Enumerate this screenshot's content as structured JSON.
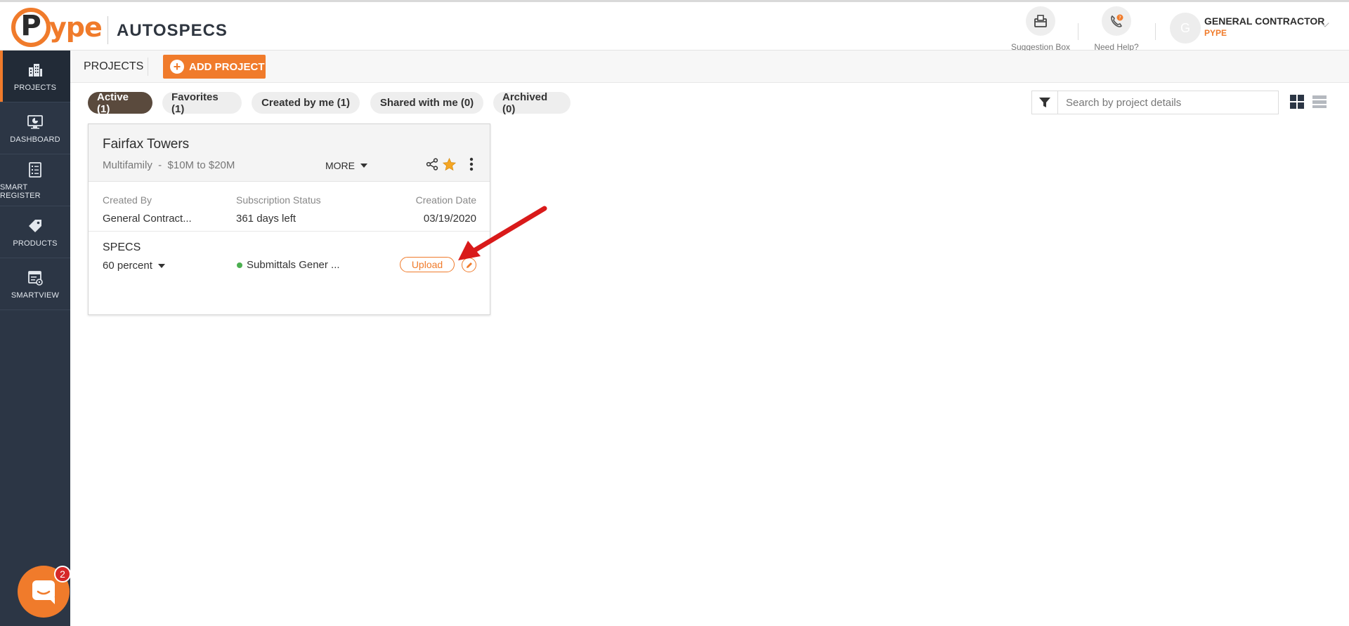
{
  "header": {
    "logo_letter": "P",
    "logo_rest": "ype",
    "app_name": "AUTOSPECS",
    "actions": [
      {
        "label": "Suggestion Box",
        "icon": "suggestion-box-icon"
      },
      {
        "label": "Need Help?",
        "icon": "phone-help-icon"
      }
    ],
    "user": {
      "initial": "G",
      "name": "GENERAL CONTRACTOR",
      "org": "PYPE"
    }
  },
  "sidebar": {
    "items": [
      {
        "label": "PROJECTS",
        "icon": "building-icon",
        "active": true
      },
      {
        "label": "DASHBOARD",
        "icon": "monitor-icon",
        "active": false
      },
      {
        "label": "SMART REGISTER",
        "icon": "register-icon",
        "active": false
      },
      {
        "label": "PRODUCTS",
        "icon": "tag-icon",
        "active": false
      },
      {
        "label": "SMARTVIEW",
        "icon": "smartview-icon",
        "active": false
      }
    ]
  },
  "subheader": {
    "title": "PROJECTS",
    "add_label": "ADD PROJECT"
  },
  "filters": {
    "tabs": [
      {
        "label": "Active (1)",
        "active": true
      },
      {
        "label": "Favorites (1)",
        "active": false
      },
      {
        "label": "Created by me (1)",
        "active": false
      },
      {
        "label": "Shared with me (0)",
        "active": false
      },
      {
        "label": "Archived (0)",
        "active": false
      }
    ],
    "search_placeholder": "Search by project details"
  },
  "project": {
    "name": "Fairfax Towers",
    "subtitle": "Multifamily  -  $10M to $20M",
    "more_label": "MORE",
    "created_by_label": "Created By",
    "created_by": "General Contract...",
    "subscription_label": "Subscription Status",
    "subscription": "361 days left",
    "creation_date_label": "Creation Date",
    "creation_date": "03/19/2020",
    "specs_title": "SPECS",
    "specs_percent": "60 percent",
    "status": "Submittals Gener ...",
    "upload_label": "Upload",
    "favorite": true
  },
  "chat": {
    "badge": "2"
  },
  "colors": {
    "brand": "#f07b2b",
    "sidebar": "#2c3645",
    "active_pill": "#5a4a3d",
    "status_green": "#4caf50",
    "arrow_red": "#d91a1a"
  }
}
